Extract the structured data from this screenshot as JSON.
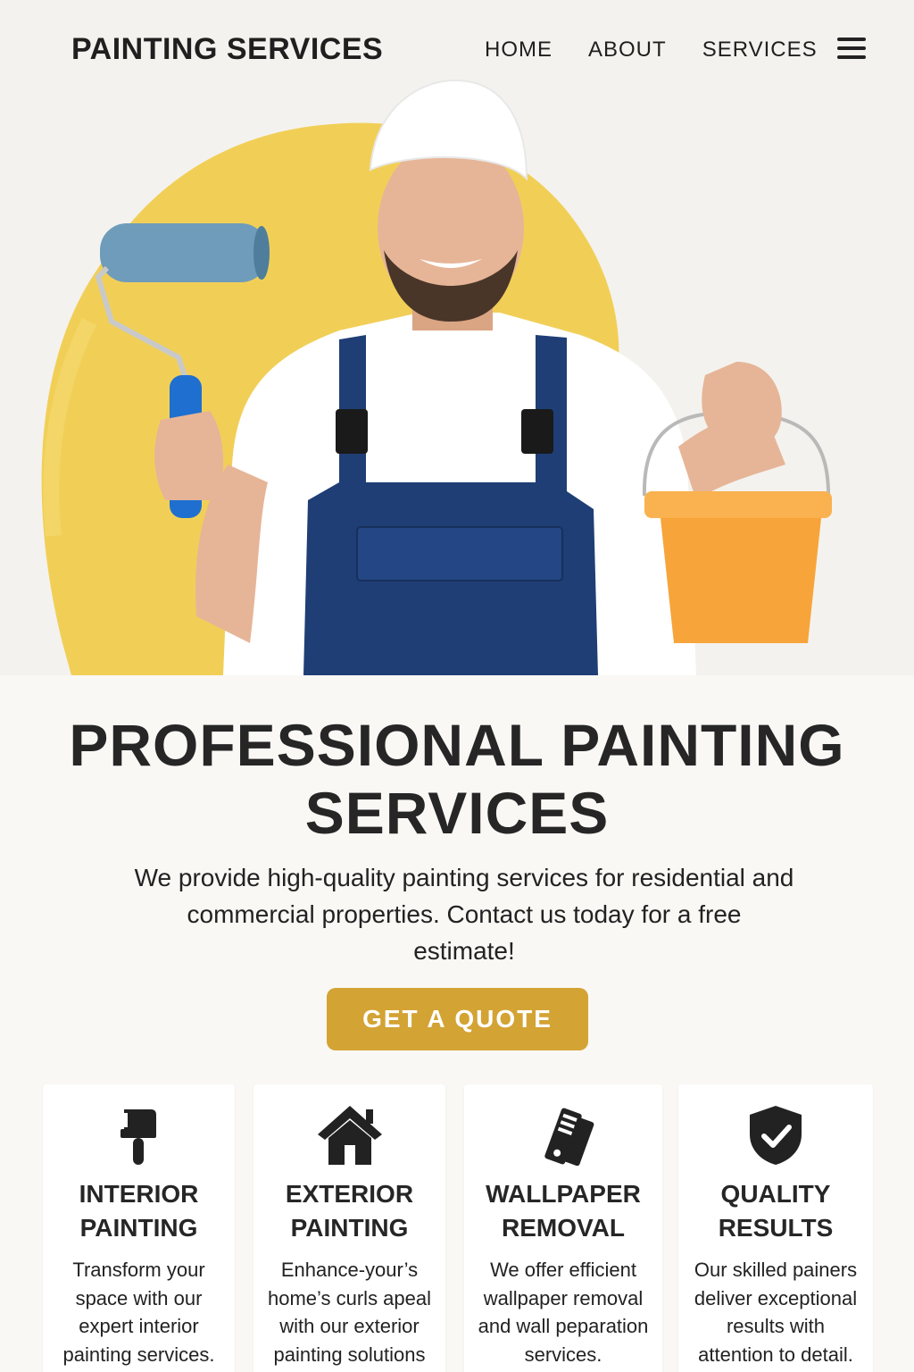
{
  "header": {
    "brand": "PAINTING SERVICES",
    "nav": [
      "HOME",
      "ABOUT",
      "SERVICES"
    ],
    "menu_icon": "hamburger-menu-icon"
  },
  "hero": {
    "image": "smiling painter in white cap and navy overalls holding a paint roller and an orange bucket in front of a yellow painted wall"
  },
  "main": {
    "headline_line1": "PROFESSIONAL PAINTING",
    "headline_line2": "SERVICES",
    "intro_line1": "We provide high-quality painting services for residential and",
    "intro_line2": "commercial properties. Contact us today for a free",
    "intro_line3": "estimate!",
    "cta_label": "GET A QUOTE"
  },
  "services": [
    {
      "icon": "paint-brush-icon",
      "title_line1": "INTERIOR",
      "title_line2": "PAINTING",
      "text_lines": [
        "Transform your",
        "space with our",
        "expert interior",
        "painting services."
      ]
    },
    {
      "icon": "house-icon",
      "title_line1": "EXTERIOR",
      "title_line2": "PAINTING",
      "text_lines": [
        "Enhance-your’s",
        "home’s curls apeal",
        "with our exterior",
        "painting solutions"
      ]
    },
    {
      "icon": "color-swatch-icon",
      "title_line1": "WALLPAPER",
      "title_line2": "REMOVAL",
      "text_lines": [
        "We offer efficient",
        "wallpaper removal",
        "and wall peparation",
        "services."
      ]
    },
    {
      "icon": "shield-check-icon",
      "title_line1": "QUALITY",
      "title_line2": "RESULTS",
      "text_lines": [
        "Our skilled painers",
        "deliver exceptional",
        "results with",
        "attention to detail."
      ]
    }
  ],
  "colors": {
    "accent": "#d3a334",
    "text": "#222222",
    "background": "#faf8f5",
    "wall_paint": "#f0cc4e",
    "overalls": "#1f3e75",
    "bucket": "#f7a43a",
    "roller": "#6f9cba"
  }
}
